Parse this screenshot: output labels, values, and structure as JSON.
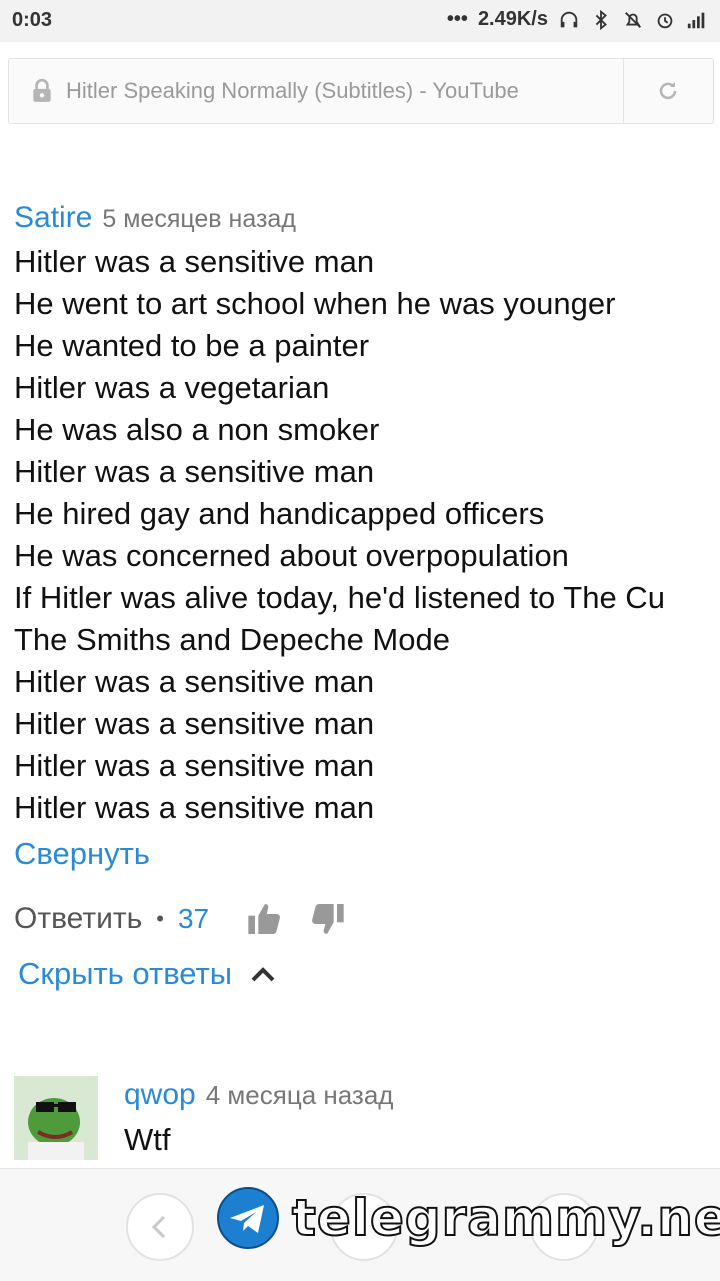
{
  "status": {
    "time": "0:03",
    "speed": "2.49K/s"
  },
  "url_bar": {
    "title": "Hitler Speaking Normally (Subtitles) - YouTube"
  },
  "comment": {
    "author": "Satire",
    "date": "5 месяцев назад",
    "lines": [
      "Hitler was a sensitive man",
      "He went to art school when he was younger",
      "He wanted to be a painter",
      "Hitler was a vegetarian",
      "He was also a non smoker",
      "Hitler was a sensitive man",
      "He hired gay and handicapped officers",
      "He was concerned about overpopulation",
      "If Hitler was alive today, he'd listened to The Cu",
      "The Smiths and Depeche Mode",
      "Hitler was a sensitive man",
      "Hitler was a sensitive man",
      "Hitler was a sensitive man",
      "Hitler was a sensitive man"
    ],
    "collapse_label": "Свернуть",
    "reply_label": "Ответить",
    "likes": "37",
    "hide_replies_label": "Скрыть ответы"
  },
  "reply": {
    "author": "qwop",
    "date": "4 месяца назад",
    "text": "Wtf"
  },
  "watermark": {
    "text": "telegrammy.net"
  },
  "colors": {
    "link": "#2a8ad6",
    "progress": "#4caf50"
  }
}
